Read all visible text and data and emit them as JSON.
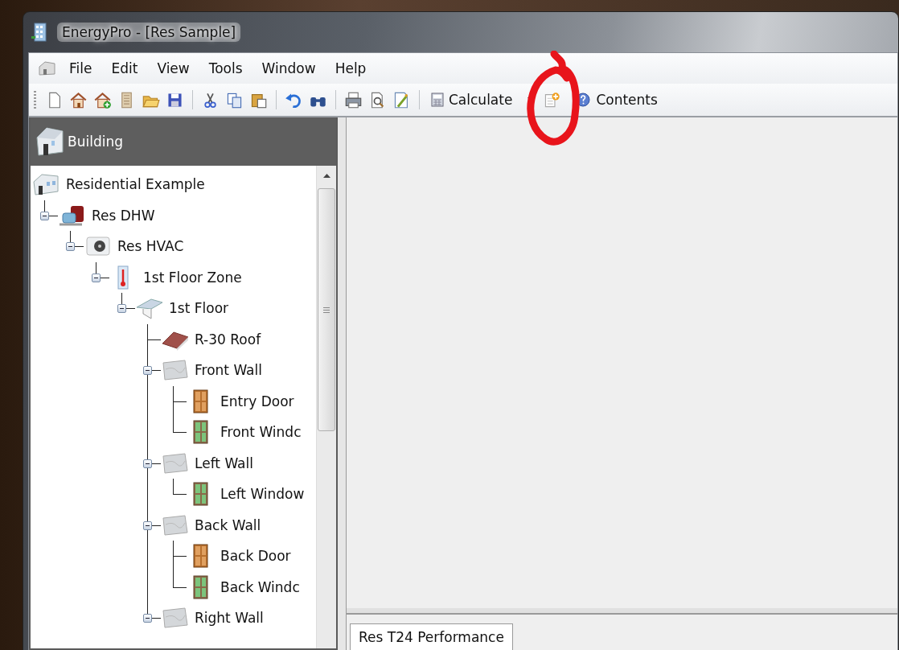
{
  "window": {
    "title": "EnergyPro - [Res Sample]"
  },
  "menu": [
    "File",
    "Edit",
    "View",
    "Tools",
    "Window",
    "Help"
  ],
  "toolbar_buttons": [
    "Calculate",
    "Contents"
  ],
  "panel": {
    "header": "Building"
  },
  "tree": [
    {
      "label": "Residential Example",
      "kind": "building",
      "children": [
        {
          "label": "Res DHW",
          "kind": "water-heater",
          "expanded": true,
          "children": [
            {
              "label": "Res HVAC",
              "kind": "hvac",
              "expanded": true,
              "children": [
                {
                  "label": "1st Floor Zone",
                  "kind": "zone",
                  "expanded": true,
                  "children": [
                    {
                      "label": "1st Floor",
                      "kind": "floor",
                      "expanded": true,
                      "children": [
                        {
                          "label": "R-30 Roof",
                          "kind": "roof"
                        },
                        {
                          "label": "Front Wall",
                          "kind": "wall",
                          "expanded": true,
                          "children": [
                            {
                              "label": "Entry Door",
                              "kind": "door"
                            },
                            {
                              "label": "Front Windc",
                              "kind": "window"
                            }
                          ]
                        },
                        {
                          "label": "Left Wall",
                          "kind": "wall",
                          "expanded": true,
                          "children": [
                            {
                              "label": "Left Window",
                              "kind": "window"
                            }
                          ]
                        },
                        {
                          "label": "Back Wall",
                          "kind": "wall",
                          "expanded": true,
                          "children": [
                            {
                              "label": "Back Door",
                              "kind": "door"
                            },
                            {
                              "label": "Back Windc",
                              "kind": "window"
                            }
                          ]
                        },
                        {
                          "label": "Right Wall",
                          "kind": "wall",
                          "expanded": true
                        }
                      ]
                    }
                  ]
                }
              ]
            }
          ]
        }
      ]
    }
  ],
  "bottom_tabs": [
    {
      "label": "Res T24 Performance",
      "selected": true
    }
  ]
}
